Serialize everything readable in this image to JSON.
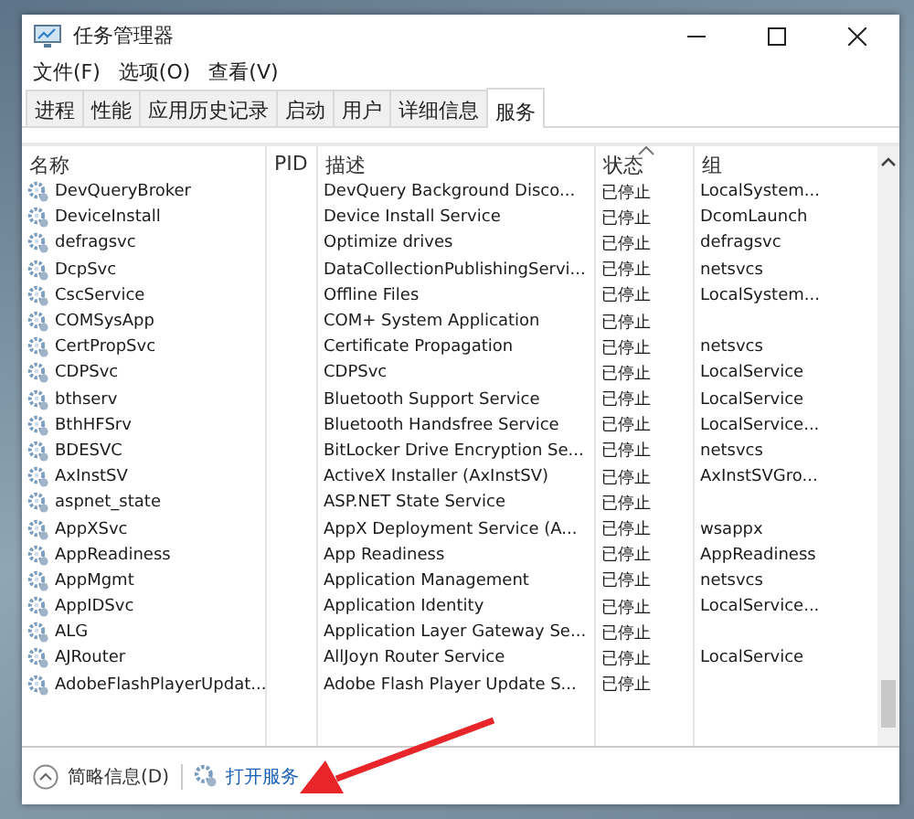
{
  "window": {
    "title": "任务管理器"
  },
  "menu": [
    "文件(F)",
    "选项(O)",
    "查看(V)"
  ],
  "tabs": [
    {
      "label": "进程",
      "selected": false
    },
    {
      "label": "性能",
      "selected": false
    },
    {
      "label": "应用历史记录",
      "selected": false
    },
    {
      "label": "启动",
      "selected": false
    },
    {
      "label": "用户",
      "selected": false
    },
    {
      "label": "详细信息",
      "selected": false
    },
    {
      "label": "服务",
      "selected": true
    }
  ],
  "table": {
    "columns": [
      {
        "label": "名称",
        "sorted": false
      },
      {
        "label": "PID",
        "sorted": false
      },
      {
        "label": "描述",
        "sorted": false
      },
      {
        "label": "状态",
        "sorted": true
      },
      {
        "label": "组",
        "sorted": false
      }
    ],
    "rows": [
      {
        "name": "DevQueryBroker",
        "description": "DevQuery Background Disco...",
        "status": "已停止",
        "group": "LocalSystem..."
      },
      {
        "name": "DeviceInstall",
        "description": "Device Install Service",
        "status": "已停止",
        "group": "DcomLaunch"
      },
      {
        "name": "defragsvc",
        "description": "Optimize drives",
        "status": "已停止",
        "group": "defragsvc"
      },
      {
        "name": "DcpSvc",
        "description": "DataCollectionPublishingServi...",
        "status": "已停止",
        "group": "netsvcs"
      },
      {
        "name": "CscService",
        "description": "Offline Files",
        "status": "已停止",
        "group": "LocalSystem..."
      },
      {
        "name": "COMSysApp",
        "description": "COM+ System Application",
        "status": "已停止"
      },
      {
        "name": "CertPropSvc",
        "description": "Certificate Propagation",
        "status": "已停止",
        "group": "netsvcs"
      },
      {
        "name": "CDPSvc",
        "description": "CDPSvc",
        "status": "已停止",
        "group": "LocalService"
      },
      {
        "name": "bthserv",
        "description": "Bluetooth Support Service",
        "status": "已停止",
        "group": "LocalService"
      },
      {
        "name": "BthHFSrv",
        "description": "Bluetooth Handsfree Service",
        "status": "已停止",
        "group": "LocalService..."
      },
      {
        "name": "BDESVC",
        "description": "BitLocker Drive Encryption Se...",
        "status": "已停止",
        "group": "netsvcs"
      },
      {
        "name": "AxInstSV",
        "description": "ActiveX Installer (AxInstSV)",
        "status": "已停止",
        "group": "AxInstSVGro..."
      },
      {
        "name": "aspnet_state",
        "description": "ASP.NET State Service",
        "status": "已停止"
      },
      {
        "name": "AppXSvc",
        "description": "AppX Deployment Service (A...",
        "status": "已停止",
        "group": "wsappx"
      },
      {
        "name": "AppReadiness",
        "description": "App Readiness",
        "status": "已停止",
        "group": "AppReadiness"
      },
      {
        "name": "AppMgmt",
        "description": "Application Management",
        "status": "已停止",
        "group": "netsvcs"
      },
      {
        "name": "AppIDSvc",
        "description": "Application Identity",
        "status": "已停止",
        "group": "LocalService..."
      },
      {
        "name": "ALG",
        "description": "Application Layer Gateway Se...",
        "status": "已停止"
      },
      {
        "name": "AJRouter",
        "description": "AllJoyn Router Service",
        "status": "已停止",
        "group": "LocalService"
      },
      {
        "name": "AdobeFlashPlayerUpdat...",
        "description": "Adobe Flash Player Update S...",
        "status": "已停止"
      }
    ]
  },
  "footer": {
    "details_toggle": "简略信息(D)",
    "open_services": "打开服务"
  }
}
